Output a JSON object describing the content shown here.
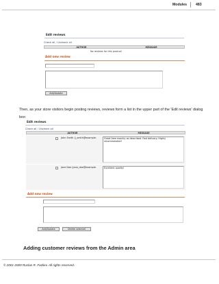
{
  "header": {
    "section": "Modules",
    "page_number": "483"
  },
  "dialog1": {
    "title": "Edit reviews",
    "check_all": "Check all",
    "separator": "/",
    "uncheck_all": "Uncheck all",
    "col_author": "AUTHOR",
    "col_message": "MESSAGE",
    "empty_message": "No reviews for this product",
    "add_title": "Add new review",
    "add_button": "Add/Update"
  },
  "paragraph": "Then, as your store visitors begin posting reviews, reviews form a list in the upper part of the 'Edit reviews' dialog box:",
  "dialog2": {
    "title": "Edit reviews",
    "check_all": "Check all",
    "separator": "/",
    "uncheck_all": "Uncheck all",
    "col_author": "AUTHOR",
    "col_message": "MESSAGE",
    "reviews": [
      {
        "author": "John Smith (j_smith@example.",
        "message": "Great item exactly as described. Fast delivery. Highly recommended!"
      },
      {
        "author": "Jane Doe (jane_doe@example.",
        "message": "Excellent quality!"
      }
    ],
    "add_title": "Add new review",
    "add_button": "Add/Update",
    "delete_button": "Delete selected"
  },
  "section_heading": "Adding customer reviews from the Admin area",
  "footer": {
    "copyright": "© 2001-2009 Ruslan R. Fazliev. All rights reserved."
  }
}
